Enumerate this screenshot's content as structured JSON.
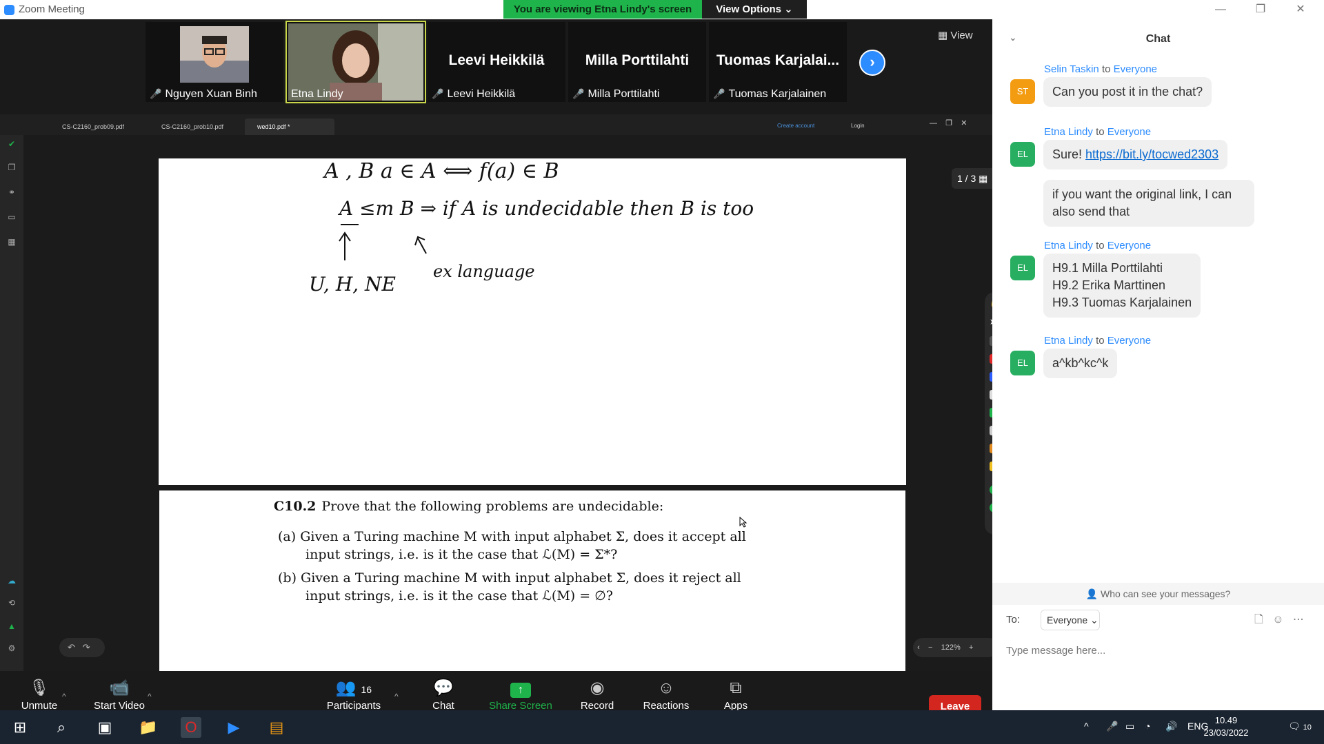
{
  "window": {
    "title": "Zoom Meeting"
  },
  "banner": {
    "viewing": "You are viewing Etna Lindy's screen",
    "view_options": "View Options"
  },
  "gallery": {
    "participants": [
      {
        "name": "Nguyen Xuan Binh",
        "display": ""
      },
      {
        "name": "Etna Lindy",
        "display": ""
      },
      {
        "name": "Leevi Heikkilä",
        "display": "Leevi Heikkilä"
      },
      {
        "name": "Milla Porttilahti",
        "display": "Milla Porttilahti"
      },
      {
        "name": "Tuomas Karjalainen",
        "display": "Tuomas  Karjalai..."
      }
    ],
    "view_label": "View"
  },
  "shared_app": {
    "tabs": [
      "CS-C2160_prob09.pdf",
      "CS-C2160_prob10.pdf",
      "wed10.pdf *"
    ],
    "create_account": "Create account",
    "login": "Login",
    "page_indicator": "1 / 3",
    "zoom": "122%",
    "handwriting": {
      "line1": "A , B          a ∈ A  ⟺  f(a) ∈ B",
      "line2": "A ≤m B  ⇒  if  A  is  undecidable  then  B  is  too",
      "line3": "U, H, NE",
      "line4": "ex language"
    },
    "problem": {
      "number": "C10.2",
      "title": "Prove that the following problems are undecidable:",
      "a1": "(a)  Given a Turing machine M with input alphabet Σ, does it accept all",
      "a2": "input strings, i.e. is it the case that ℒ(M) = Σ*?",
      "b1": "(b)  Given a Turing machine M with input alphabet Σ, does it reject all",
      "b2": "input strings, i.e. is it the case that ℒ(M) = ∅?"
    }
  },
  "toolbar": {
    "unmute": "Unmute",
    "start_video": "Start Video",
    "participants": "Participants",
    "participants_count": "16",
    "chat": "Chat",
    "share_screen": "Share Screen",
    "record": "Record",
    "reactions": "Reactions",
    "apps": "Apps",
    "leave": "Leave"
  },
  "chat": {
    "title": "Chat",
    "messages": [
      {
        "initials": "ST",
        "color": "#f39c12",
        "sender": "Selin Taskin",
        "to": "to",
        "target": "Everyone",
        "text": "Can you post it in the chat?"
      },
      {
        "initials": "EL",
        "color": "#27ae60",
        "sender": "Etna Lindy",
        "to": "to",
        "target": "Everyone",
        "text": "Sure! ",
        "link": "https://bit.ly/tocwed2303",
        "extra1": "if you want the original link, I can",
        "extra2": "also send that"
      },
      {
        "initials": "EL",
        "color": "#27ae60",
        "sender": "Etna Lindy",
        "to": "to",
        "target": "Everyone",
        "line1": "H9.1 Milla Porttilahti",
        "line2": "H9.2 Erika Marttinen",
        "line3": "H9.3 Tuomas Karjalainen"
      },
      {
        "initials": "EL",
        "color": "#27ae60",
        "sender": "Etna Lindy",
        "to": "to",
        "target": "Everyone",
        "text": "a^kb^kc^k"
      }
    ],
    "who_can_see": "Who can see your messages?",
    "to_label": "To:",
    "recipient": "Everyone",
    "placeholder": "Type message here..."
  },
  "taskbar": {
    "language": "ENG",
    "time": "10.49",
    "date": "23/03/2022",
    "notifications": "10"
  }
}
